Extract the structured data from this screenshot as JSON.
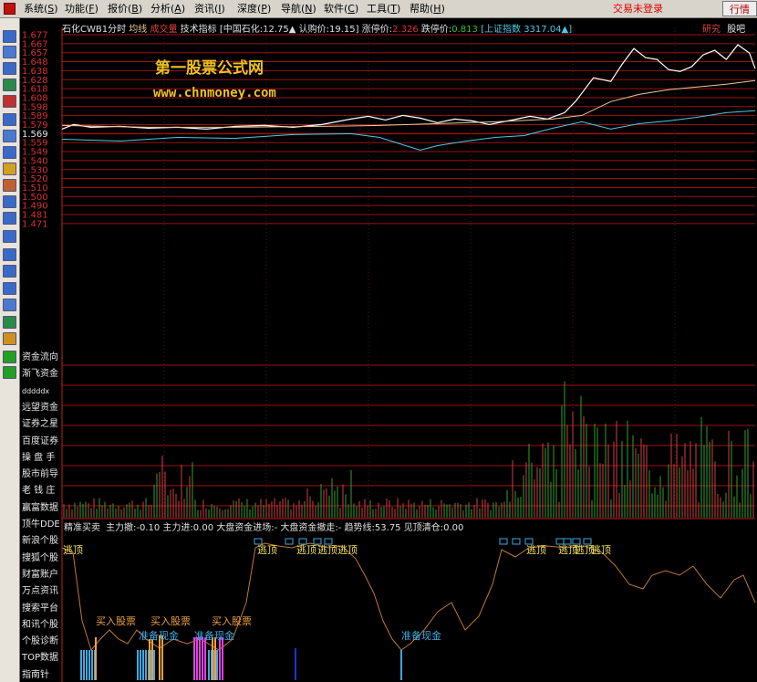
{
  "menu": {
    "items": [
      {
        "label": "系统(",
        "key": "S",
        "end": ")"
      },
      {
        "label": "功能(",
        "key": "F",
        "end": ")"
      },
      {
        "label": "报价(",
        "key": "B",
        "end": ")"
      },
      {
        "label": "分析(",
        "key": "A",
        "end": ")"
      },
      {
        "label": "资讯(",
        "key": "I",
        "end": ")"
      },
      {
        "label": "深度(",
        "key": "P",
        "end": ")"
      },
      {
        "label": "导航(",
        "key": "N",
        "end": ")"
      },
      {
        "label": "软件(",
        "key": "C",
        "end": ")"
      },
      {
        "label": "工具(",
        "key": "T",
        "end": ")"
      },
      {
        "label": "帮助(",
        "key": "H",
        "end": ")"
      }
    ],
    "login_status": "交易未登录",
    "right_button": "行情"
  },
  "header": {
    "stock": "石化CWB1分时",
    "avg_label": "均线",
    "vol_label": "成交量",
    "tech_label": "技术指标",
    "info": "[中国石化:12.75▲ 认购价:19.15] 涨停价:",
    "limit_up": "2.326",
    "limit_down_label": "跌停价:",
    "limit_down": "0.813",
    "index_label": "[上证指数",
    "index_value": "3317.04▲]",
    "research_tab": "研究",
    "guba_tab": "股吧"
  },
  "watermark": {
    "title": "第一股票公式网",
    "url": "www.chnmoney.com"
  },
  "price_axis": [
    "1.677",
    "1.667",
    "1.657",
    "1.648",
    "1.638",
    "1.628",
    "1.618",
    "1.608",
    "1.598",
    "1.589",
    "1.579",
    "1.569",
    "1.559",
    "1.549",
    "1.540",
    "1.530",
    "1.520",
    "1.510",
    "1.500",
    "1.490",
    "1.481",
    "1.471"
  ],
  "ref_price_index": 11,
  "side_menu": [
    "资金流向",
    "渐飞资金",
    "dddddx",
    "远望资金",
    "证券之星",
    "百度证券",
    "操 盘 手",
    "股市前导",
    "老 钱 庄",
    "赢富数据",
    "顶牛DDE",
    "新浪个股",
    "搜狐个股",
    "财富账户",
    "万点资讯",
    "搜索平台",
    "和讯个股",
    "个股诊断",
    "TOP数据",
    "指南针"
  ],
  "indicator": {
    "name": "精准买卖",
    "fields": "主力撤:-0.10  主力进:0.00  大盘资金进场:-  大盘资金撤走:-  趋势线:53.75  见顶清仓:0.00"
  },
  "signals": {
    "escape": "逃顶",
    "buy": "买入股票",
    "cash": "准备现金"
  },
  "colors": {
    "price_line": "#ffffff",
    "avg_line": "#e8c898",
    "cyan_line": "#4ec8e8",
    "grid": "#a01010",
    "axis_text": "#d83030",
    "vol_up": "#d04040",
    "vol_down": "#30a030",
    "trend_line": "#c07830",
    "signal_yellow": "#f0e060",
    "signal_orange": "#f0a040",
    "signal_cyan": "#40a8e0",
    "signal_magenta": "#e040e0"
  },
  "chart_data": {
    "type": "line",
    "x_range": [
      0,
      240
    ],
    "ylim": [
      1.471,
      1.677
    ],
    "series": [
      {
        "values": [
          [
            0,
            1.574
          ],
          [
            4,
            1.579
          ],
          [
            10,
            1.576
          ],
          [
            20,
            1.577
          ],
          [
            30,
            1.575
          ],
          [
            40,
            1.576
          ],
          [
            50,
            1.574
          ],
          [
            60,
            1.577
          ],
          [
            70,
            1.578
          ],
          [
            80,
            1.576
          ],
          [
            90,
            1.579
          ],
          [
            100,
            1.585
          ],
          [
            106,
            1.588
          ],
          [
            112,
            1.584
          ],
          [
            118,
            1.589
          ],
          [
            124,
            1.586
          ],
          [
            130,
            1.581
          ],
          [
            136,
            1.585
          ],
          [
            142,
            1.583
          ],
          [
            148,
            1.579
          ],
          [
            156,
            1.584
          ],
          [
            162,
            1.588
          ],
          [
            168,
            1.585
          ],
          [
            174,
            1.592
          ],
          [
            178,
            1.605
          ],
          [
            184,
            1.63
          ],
          [
            190,
            1.626
          ],
          [
            194,
            1.645
          ],
          [
            198,
            1.662
          ],
          [
            202,
            1.652
          ],
          [
            206,
            1.65
          ],
          [
            210,
            1.639
          ],
          [
            214,
            1.637
          ],
          [
            218,
            1.642
          ],
          [
            222,
            1.655
          ],
          [
            226,
            1.66
          ],
          [
            230,
            1.65
          ],
          [
            234,
            1.666
          ],
          [
            238,
            1.657
          ],
          [
            240,
            1.64
          ]
        ]
      },
      {
        "values": [
          [
            0,
            1.578
          ],
          [
            30,
            1.576
          ],
          [
            60,
            1.576
          ],
          [
            90,
            1.577
          ],
          [
            110,
            1.578
          ],
          [
            130,
            1.58
          ],
          [
            150,
            1.582
          ],
          [
            170,
            1.585
          ],
          [
            180,
            1.589
          ],
          [
            190,
            1.604
          ],
          [
            200,
            1.612
          ],
          [
            210,
            1.617
          ],
          [
            220,
            1.62
          ],
          [
            230,
            1.623
          ],
          [
            240,
            1.627
          ]
        ]
      },
      {
        "values": [
          [
            0,
            1.563
          ],
          [
            20,
            1.561
          ],
          [
            40,
            1.565
          ],
          [
            60,
            1.564
          ],
          [
            80,
            1.568
          ],
          [
            100,
            1.569
          ],
          [
            110,
            1.565
          ],
          [
            116,
            1.559
          ],
          [
            124,
            1.551
          ],
          [
            130,
            1.556
          ],
          [
            140,
            1.561
          ],
          [
            150,
            1.565
          ],
          [
            160,
            1.567
          ],
          [
            170,
            1.575
          ],
          [
            180,
            1.582
          ],
          [
            190,
            1.574
          ],
          [
            200,
            1.58
          ],
          [
            210,
            1.583
          ],
          [
            220,
            1.587
          ],
          [
            230,
            1.592
          ],
          [
            240,
            1.594
          ]
        ]
      }
    ]
  }
}
